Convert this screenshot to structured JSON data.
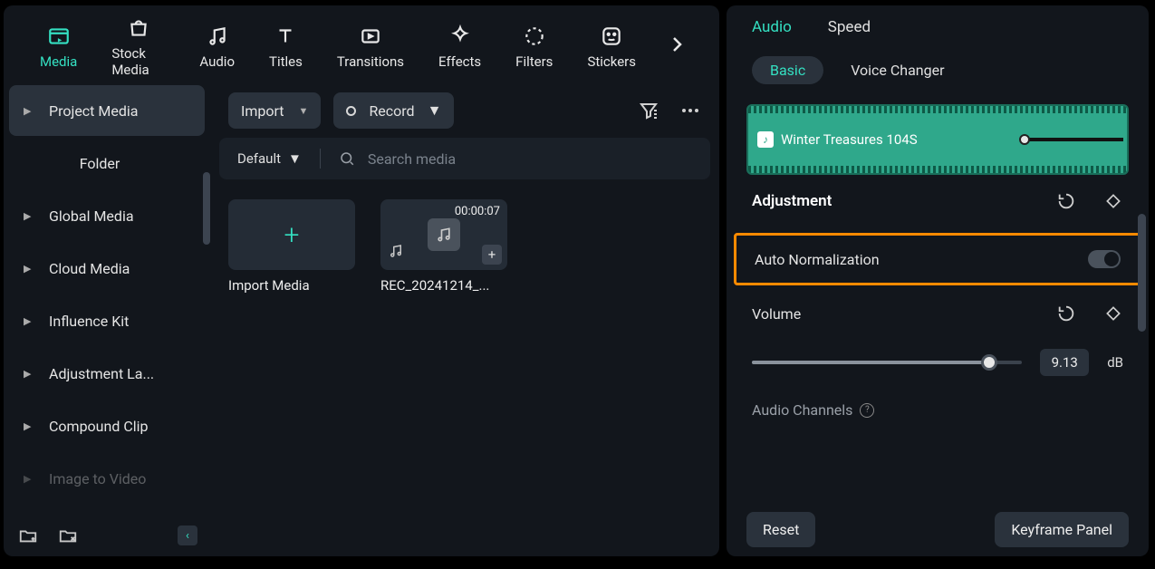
{
  "topnav": {
    "items": [
      {
        "label": "Media",
        "icon": "media",
        "active": true
      },
      {
        "label": "Stock Media",
        "icon": "bag"
      },
      {
        "label": "Audio",
        "icon": "music"
      },
      {
        "label": "Titles",
        "icon": "titles"
      },
      {
        "label": "Transitions",
        "icon": "transitions"
      },
      {
        "label": "Effects",
        "icon": "effects"
      },
      {
        "label": "Filters",
        "icon": "filters"
      },
      {
        "label": "Stickers",
        "icon": "stickers"
      }
    ]
  },
  "sidebar": {
    "items": [
      {
        "label": "Project Media",
        "active": true,
        "caret": true
      },
      {
        "label": "Folder",
        "folder": true
      },
      {
        "label": "Global Media",
        "caret": true
      },
      {
        "label": "Cloud Media",
        "caret": true
      },
      {
        "label": "Influence Kit",
        "caret": true
      },
      {
        "label": "Adjustment La...",
        "caret": true
      },
      {
        "label": "Compound Clip",
        "caret": true
      },
      {
        "label": "Image to Video",
        "caret": true,
        "dim": true
      }
    ]
  },
  "toolbar": {
    "import_label": "Import",
    "record_label": "Record",
    "sort_label": "Default",
    "search_placeholder": "Search media"
  },
  "grid": {
    "items": [
      {
        "kind": "import",
        "label": "Import Media"
      },
      {
        "kind": "audio",
        "label": "REC_20241214_...",
        "duration": "00:00:07"
      }
    ]
  },
  "right": {
    "tabs": [
      {
        "label": "Audio",
        "active": true
      },
      {
        "label": "Speed"
      }
    ],
    "subtabs": {
      "basic": "Basic",
      "voice_changer": "Voice Changer"
    },
    "clip_name": "Winter Treasures 104S",
    "adjustment_label": "Adjustment",
    "auto_norm_label": "Auto Normalization",
    "auto_norm_on": false,
    "volume_label": "Volume",
    "volume_value": "9.13",
    "volume_unit": "dB",
    "channels_label": "Audio Channels",
    "reset_label": "Reset",
    "keyframe_label": "Keyframe Panel"
  }
}
